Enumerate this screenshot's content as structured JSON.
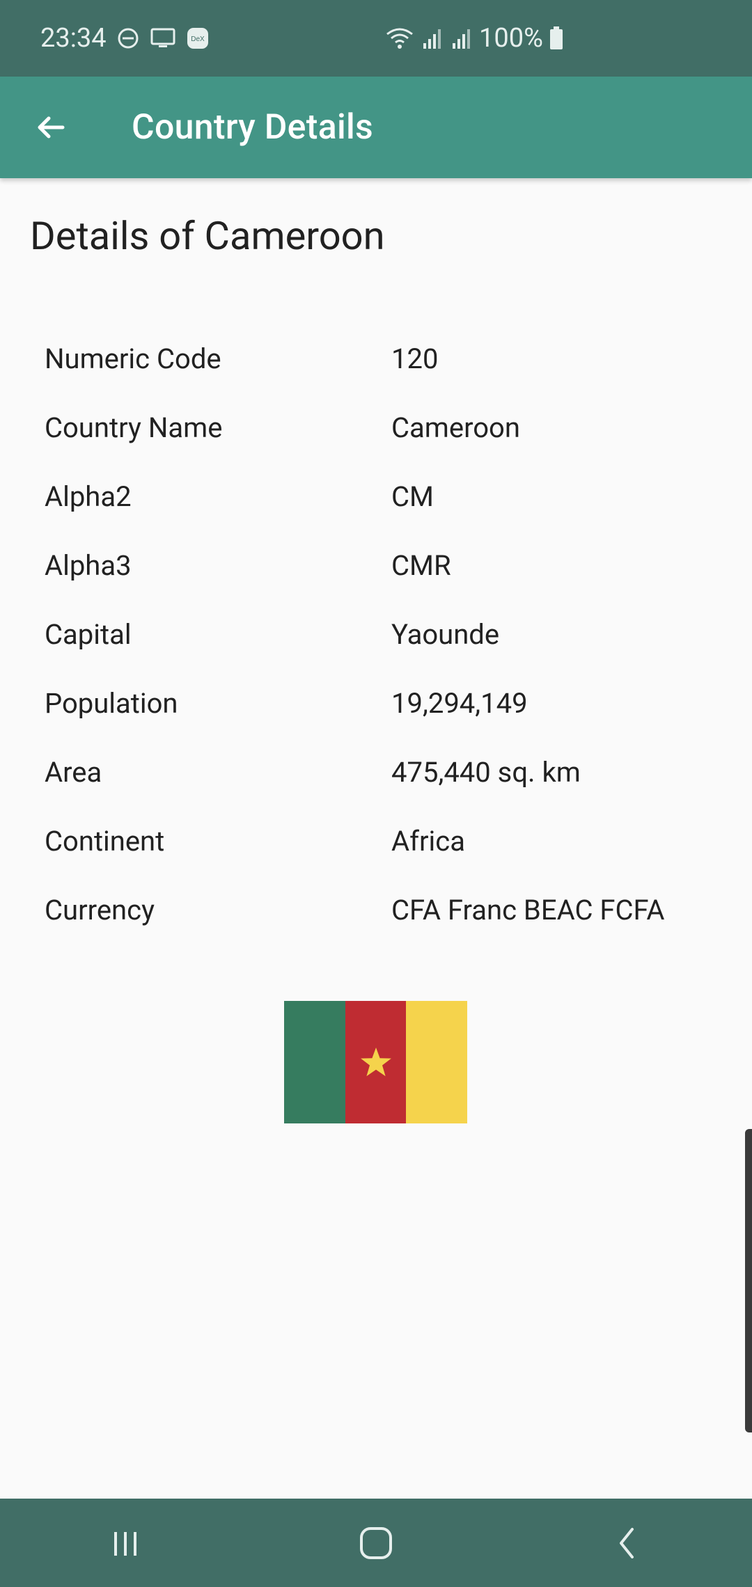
{
  "status_bar": {
    "time": "23:34",
    "battery": "100%",
    "icons": [
      "do-not-disturb-icon",
      "screen-cast-icon",
      "dex-icon",
      "wifi-icon",
      "signal-icon",
      "signal-icon",
      "battery-icon"
    ],
    "dex_label": "DeX"
  },
  "app_bar": {
    "title": "Country Details",
    "back_icon": "arrow-back-icon"
  },
  "page": {
    "title": "Details of Cameroon"
  },
  "details": [
    {
      "label": "Numeric Code",
      "value": "120"
    },
    {
      "label": "Country Name",
      "value": "Cameroon"
    },
    {
      "label": "Alpha2",
      "value": "CM"
    },
    {
      "label": "Alpha3",
      "value": "CMR"
    },
    {
      "label": "Capital",
      "value": "Yaounde"
    },
    {
      "label": "Population",
      "value": "19,294,149"
    },
    {
      "label": "Area",
      "value": "475,440 sq. km"
    },
    {
      "label": "Continent",
      "value": "Africa"
    },
    {
      "label": "Currency",
      "value": "CFA Franc BEAC FCFA"
    }
  ],
  "flag": {
    "colors": [
      "#367c5f",
      "#bf2c32",
      "#f5d34c"
    ],
    "star_color": "#f5d34c"
  },
  "nav_bar": {
    "icons": [
      "recent-apps-icon",
      "home-icon",
      "back-icon"
    ]
  },
  "colors": {
    "status_bar": "#416e66",
    "app_bar": "#439586",
    "background": "#fafafa"
  }
}
